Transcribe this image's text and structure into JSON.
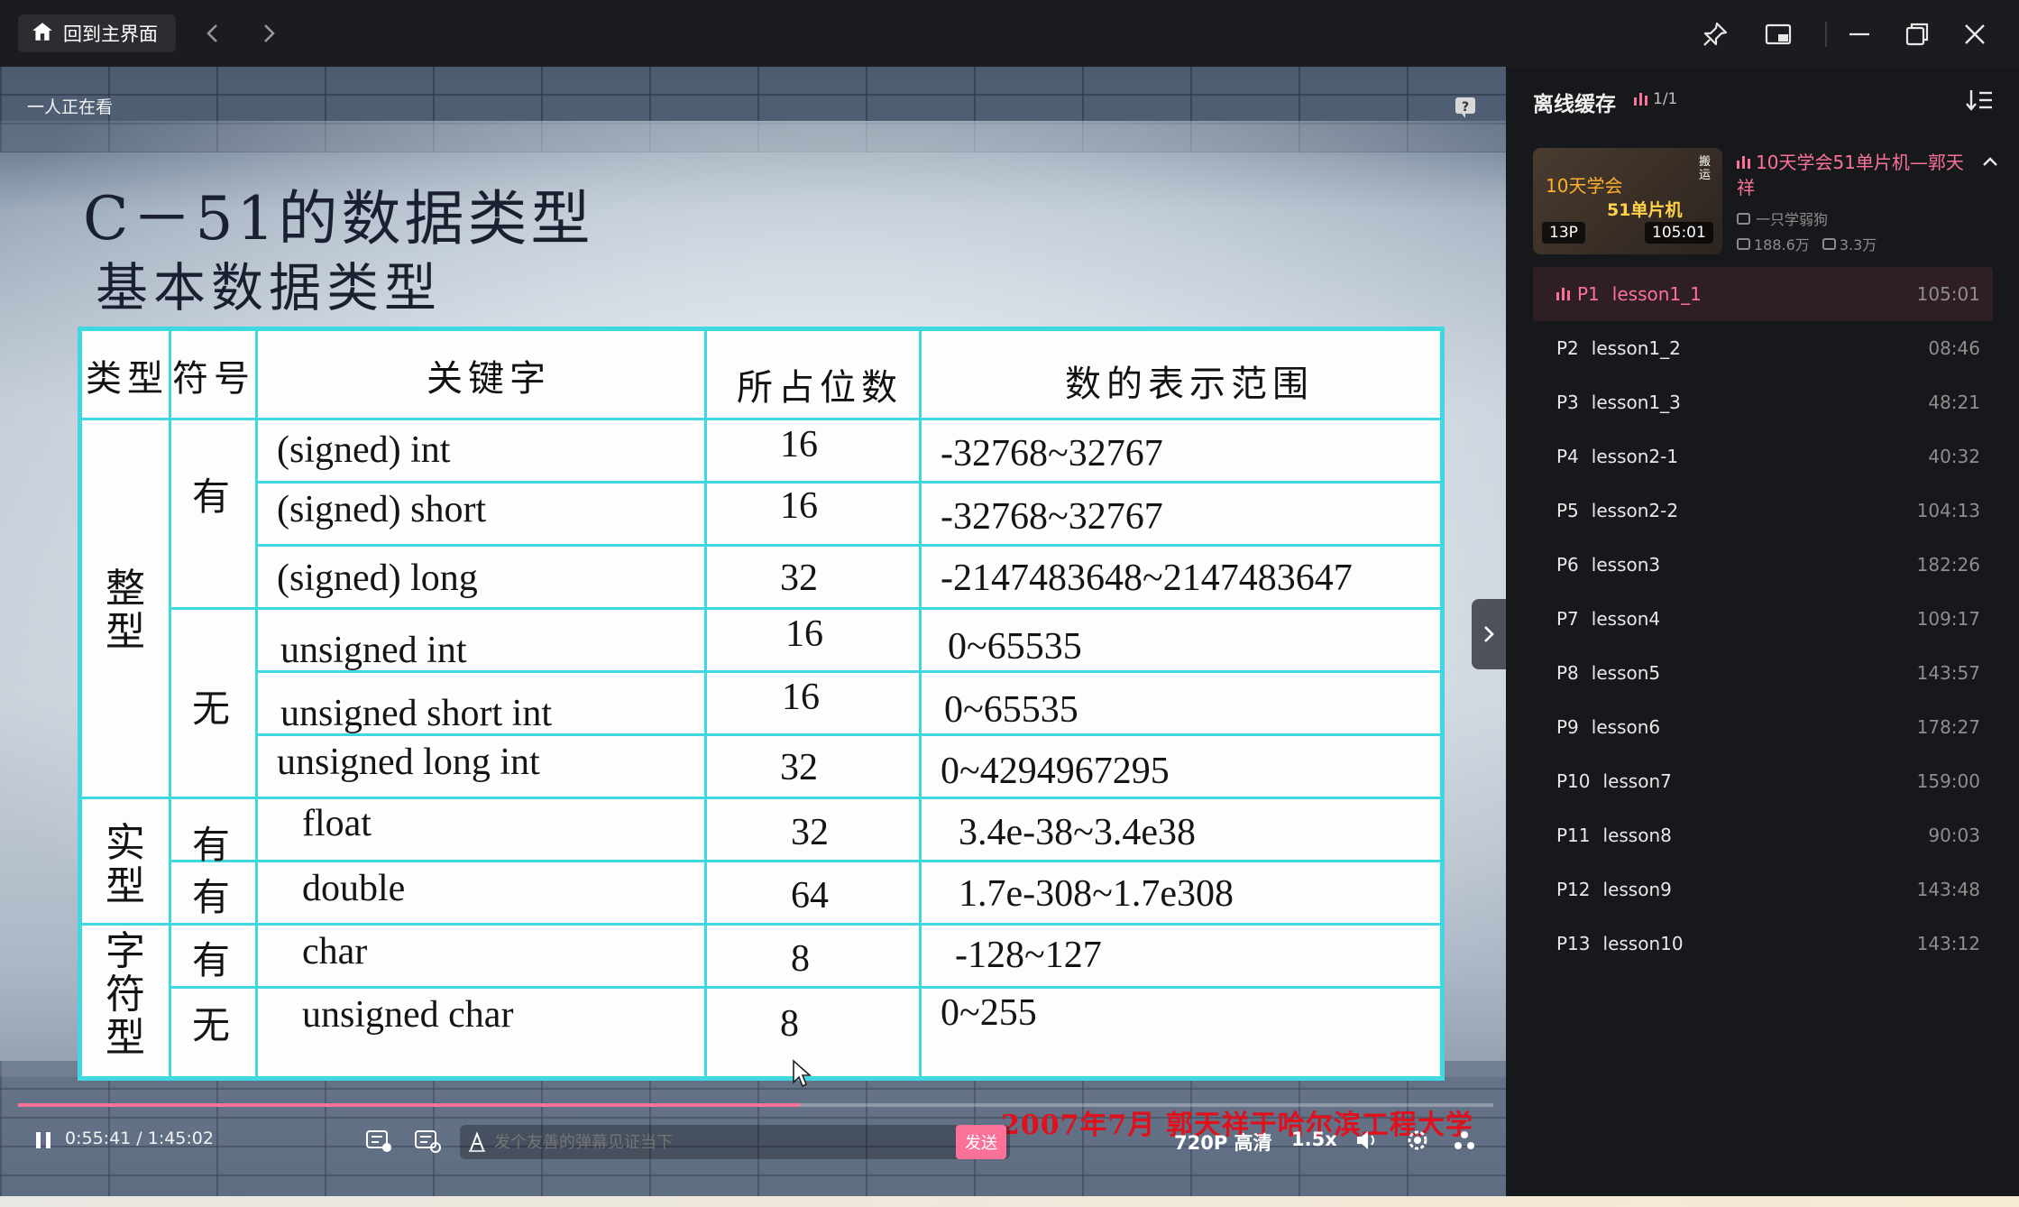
{
  "titlebar": {
    "home_label": "回到主界面",
    "icons": [
      "home-icon",
      "back-arrow-icon",
      "forward-arrow-icon",
      "pin-icon",
      "mini-window-icon",
      "minimize-icon",
      "restore-icon",
      "close-icon"
    ]
  },
  "video": {
    "viewers": "一人正在看",
    "slide_title": "C－51的数据类型",
    "slide_subtitle": "基本数据类型",
    "table": {
      "headers": [
        "类型",
        "符号",
        "关键字",
        "所占位数",
        "数的表示范围"
      ],
      "categories": [
        "整型",
        "实型",
        "字符型"
      ],
      "signs": [
        "有",
        "无",
        "有",
        "有",
        "有",
        "无"
      ],
      "rows": [
        {
          "keyword": "(signed) int",
          "bits": "16",
          "range": "-32768~32767"
        },
        {
          "keyword": "(signed) short",
          "bits": "16",
          "range": "-32768~32767"
        },
        {
          "keyword": "(signed) long",
          "bits": "32",
          "range": "-2147483648~2147483647"
        },
        {
          "keyword": "unsigned int",
          "bits": "16",
          "range": "0~65535"
        },
        {
          "keyword": "unsigned short int",
          "bits": "16",
          "range": "0~65535"
        },
        {
          "keyword": "unsigned long int",
          "bits": "32",
          "range": "0~4294967295"
        },
        {
          "keyword": "float",
          "bits": "32",
          "range": "3.4e-38~3.4e38"
        },
        {
          "keyword": "double",
          "bits": "64",
          "range": "1.7e-308~1.7e308"
        },
        {
          "keyword": "char",
          "bits": "8",
          "range": "-128~127"
        },
        {
          "keyword": "unsigned char",
          "bits": "8",
          "range": "0~255"
        }
      ]
    },
    "footer_note": "2007年7月  郭天祥于哈尔滨工程大学"
  },
  "controls": {
    "current_time": "0:55:41",
    "total_time": "1:45:02",
    "time_display": "0:55:41 / 1:45:02",
    "progress_fraction": 0.53,
    "danmaku_placeholder": "发个友善的弹幕见证当下",
    "send_label": "发送",
    "quality_label": "720P 高清",
    "speed_label": "1.5x",
    "accent_color": "#fb7299"
  },
  "panel": {
    "title": "离线缓存",
    "count": "1/1",
    "series": {
      "thumb_text1": "10天学会",
      "thumb_text2": "51单片机",
      "thumb_tag": "搬运",
      "parts": "13P",
      "duration": "105:01",
      "title": "10天学会51单片机—郭天祥",
      "author": "一只学弱狗",
      "views": "188.6万",
      "danmaku": "3.3万"
    },
    "episodes": [
      {
        "no": "P1",
        "name": "lesson1_1",
        "duration": "105:01",
        "active": true
      },
      {
        "no": "P2",
        "name": "lesson1_2",
        "duration": "08:46"
      },
      {
        "no": "P3",
        "name": "lesson1_3",
        "duration": "48:21"
      },
      {
        "no": "P4",
        "name": "lesson2-1",
        "duration": "40:32"
      },
      {
        "no": "P5",
        "name": "lesson2-2",
        "duration": "104:13"
      },
      {
        "no": "P6",
        "name": "lesson3",
        "duration": "182:26"
      },
      {
        "no": "P7",
        "name": "lesson4",
        "duration": "109:17"
      },
      {
        "no": "P8",
        "name": "lesson5",
        "duration": "143:57"
      },
      {
        "no": "P9",
        "name": "lesson6",
        "duration": "178:27"
      },
      {
        "no": "P10",
        "name": "lesson7",
        "duration": "159:00"
      },
      {
        "no": "P11",
        "name": "lesson8",
        "duration": "90:03"
      },
      {
        "no": "P12",
        "name": "lesson9",
        "duration": "143:48"
      },
      {
        "no": "P13",
        "name": "lesson10",
        "duration": "143:12"
      }
    ]
  }
}
